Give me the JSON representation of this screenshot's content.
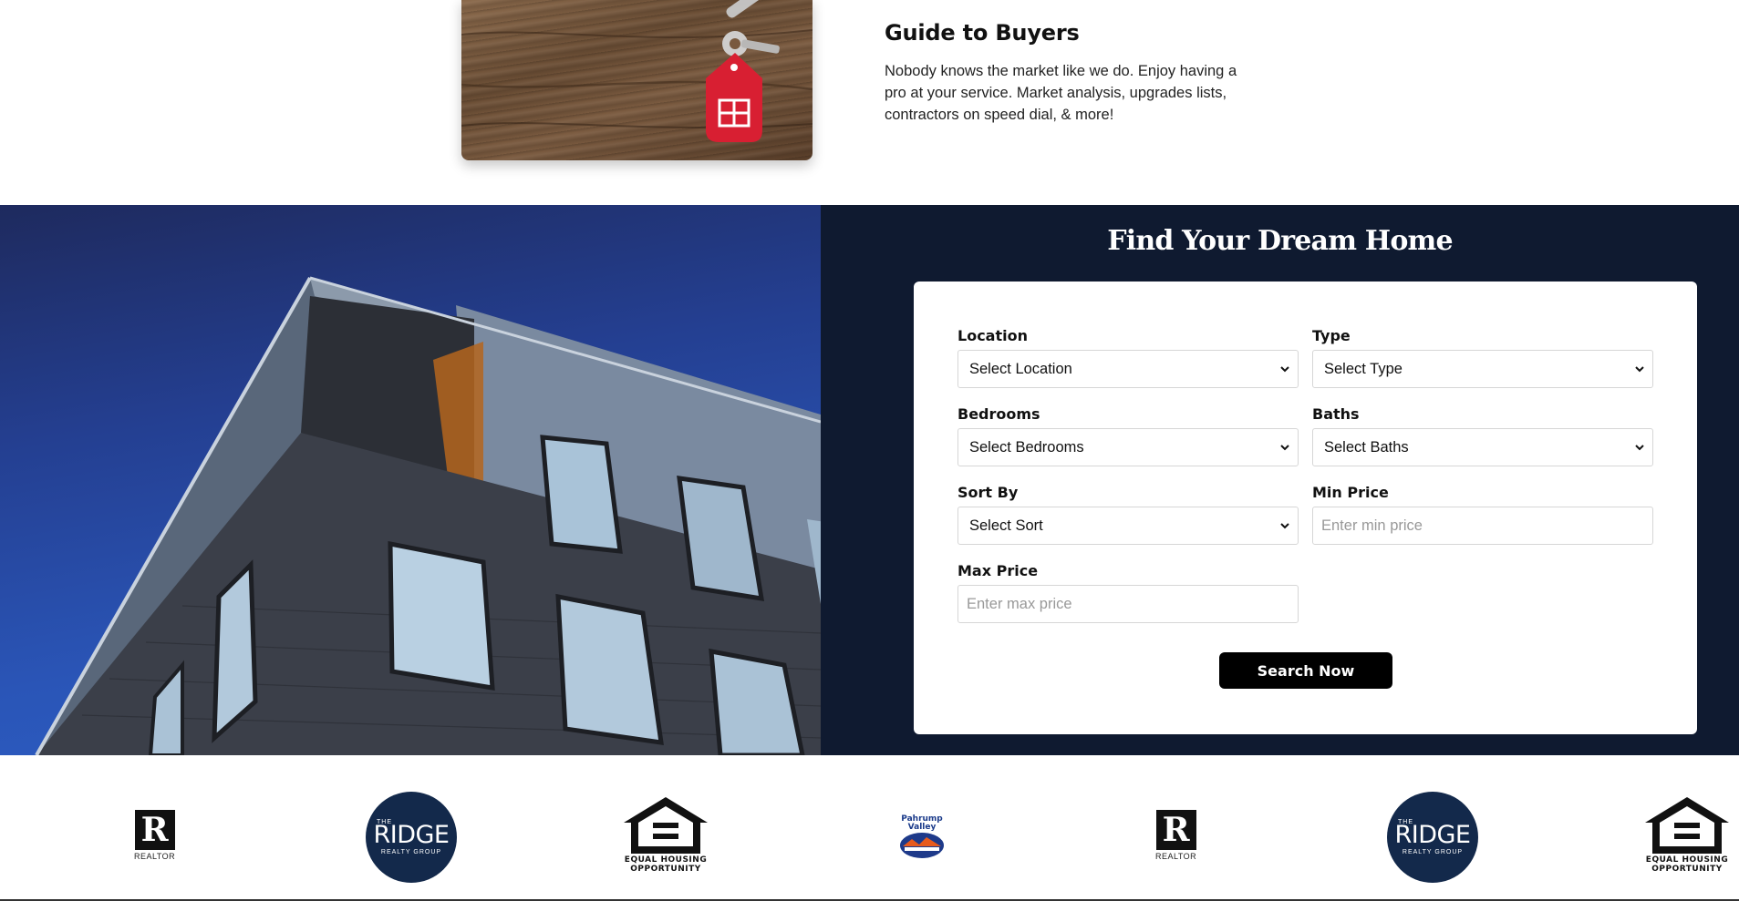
{
  "guide": {
    "title": "Guide to Buyers",
    "description": "Nobody knows the market like we do. Enjoy having a pro at your service. Market analysis, upgrades lists, contractors on speed dial, & more!"
  },
  "search": {
    "title": "Find Your Dream Home",
    "fields": {
      "location": {
        "label": "Location",
        "value": "Select Location"
      },
      "type": {
        "label": "Type",
        "value": "Select Type"
      },
      "bedrooms": {
        "label": "Bedrooms",
        "value": "Select Bedrooms"
      },
      "baths": {
        "label": "Baths",
        "value": "Select Baths"
      },
      "sort": {
        "label": "Sort By",
        "value": "Select Sort"
      },
      "min_price": {
        "label": "Min Price",
        "placeholder": "Enter min price"
      },
      "max_price": {
        "label": "Max Price",
        "placeholder": "Enter max price"
      }
    },
    "button_label": "Search Now"
  },
  "logos": {
    "realtor_label": "REALTOR",
    "ridge": {
      "the": "THE",
      "main": "RIDGE",
      "sub": "REALTY GROUP"
    },
    "eho_line1": "EQUAL HOUSING",
    "eho_line2": "OPPORTUNITY",
    "pahrump_line1": "Pahrump",
    "pahrump_line2": "Valley"
  },
  "colors": {
    "panel_bg": "#0f1a30",
    "button_bg": "#000000",
    "ridge_bg": "#13294b"
  }
}
